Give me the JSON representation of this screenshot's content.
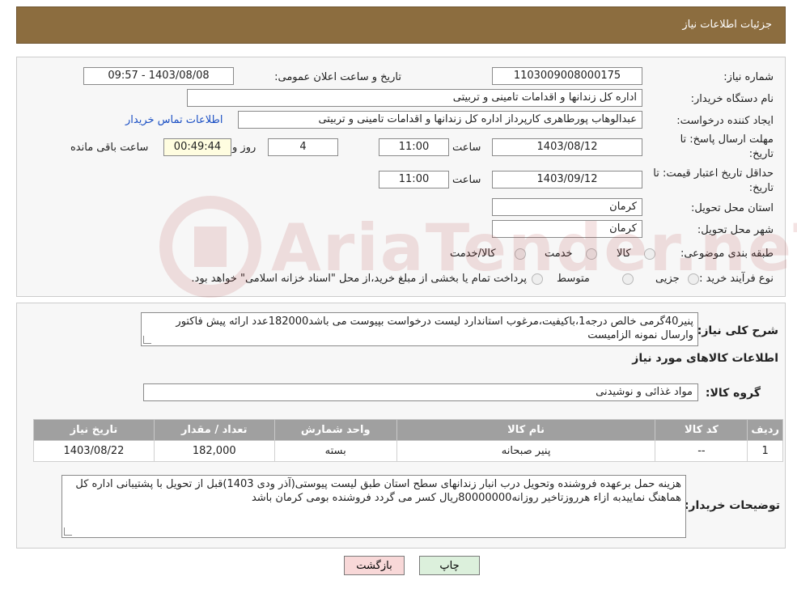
{
  "header": {
    "title": "جزئیات اطلاعات نیاز"
  },
  "form": {
    "need_number_label": "شماره نیاز:",
    "need_number": "1103009008000175",
    "announce_label": "تاریخ و ساعت اعلان عمومی:",
    "announce_value": "1403/08/08 - 09:57",
    "buyer_org_label": "نام دستگاه خریدار:",
    "buyer_org": "اداره کل زندانها و اقدامات تامینی و تربیتی",
    "creator_label": "ایجاد کننده درخواست:",
    "creator": "عبدالوهاب پورطاهری کارپرداز اداره کل زندانها و اقدامات تامینی و تربیتی",
    "contact_link": "اطلاعات تماس خریدار",
    "reply_deadline_label_1": "مهلت ارسال پاسخ: تا",
    "reply_deadline_label_2": "تاریخ:",
    "reply_date": "1403/08/12",
    "time_label": "ساعت",
    "reply_time": "11:00",
    "days_value": "4",
    "days_label": "روز و",
    "remaining_value": "00:49:44",
    "remaining_label": "ساعت باقی مانده",
    "price_valid_label_1": "حداقل تاریخ اعتبار قیمت: تا",
    "price_valid_label_2": "تاریخ:",
    "price_valid_date": "1403/09/12",
    "price_valid_time": "11:00",
    "province_label": "استان محل تحویل:",
    "province": "کرمان",
    "city_label": "شهر محل تحویل:",
    "city": "کرمان",
    "category_label": "طبقه بندی موضوعی:",
    "category_options": [
      "کالا",
      "خدمت",
      "کالا/خدمت"
    ],
    "process_label": "نوع فرآیند خرید :",
    "process_options": [
      "جزیی",
      "متوسط"
    ],
    "process_note": "پرداخت تمام یا بخشی از مبلغ خرید،از محل \"اسناد خزانه اسلامی\" خواهد بود."
  },
  "details": {
    "summary_label": "شرح کلی نیاز:",
    "summary": "پنیر40گرمی خالص درجه1،باکیفیت،مرغوب استاندارد لیست درخواست بپیوست می باشد182000عدد ارائه پیش فاکتور وارسال نمونه الزامیست",
    "goods_info_title": "اطلاعات کالاهای مورد نیاز",
    "goods_group_label": "گروه کالا:",
    "goods_group": "مواد غذائی و نوشیدنی",
    "table": {
      "headers": [
        "ردیف",
        "کد کالا",
        "نام کالا",
        "واحد شمارش",
        "تعداد / مقدار",
        "تاریخ نیاز"
      ],
      "rows": [
        [
          "1",
          "--",
          "پنیر صبحانه",
          "بسته",
          "182,000",
          "1403/08/22"
        ]
      ]
    },
    "buyer_notes_label": "توضیحات خریدار:",
    "buyer_notes": "هزینه حمل برعهده فروشنده وتحویل درب انبار زندانهای سطح استان طبق لیست پیوستی(آذر ودی 1403)قبل از تحویل با پشتیبانی اداره کل هماهنگ نمایید‌به ازاء هرروزتاخیر روزانه80000000ریال کسر می گردد فروشنده بومی کرمان باشد"
  },
  "buttons": {
    "print": "چاپ",
    "back": "بازگشت"
  },
  "colors": {
    "header": "#8c6d3f",
    "link": "#1a4fc4",
    "table_header": "#a0a0a0"
  }
}
